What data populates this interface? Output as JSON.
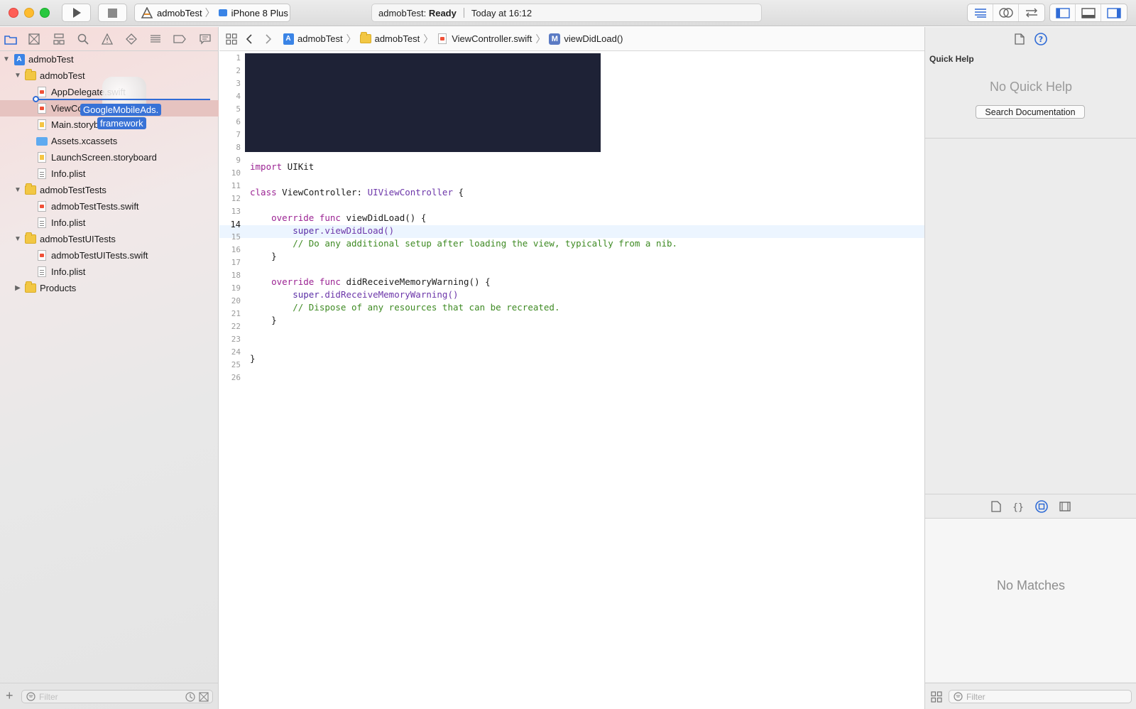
{
  "toolbar": {
    "scheme_name": "admobTest",
    "device_name": "iPhone 8 Plus",
    "status_project": "admobTest:",
    "status_state": "Ready",
    "status_time": "Today at 16:12"
  },
  "navigator": {
    "items": [
      {
        "label": "admobTest",
        "kind": "project",
        "indent": 0,
        "disclosure": "open"
      },
      {
        "label": "admobTest",
        "kind": "folder",
        "indent": 1,
        "disclosure": "open"
      },
      {
        "label": "AppDelegate.swift",
        "kind": "swift",
        "indent": 2
      },
      {
        "label": "ViewCo",
        "kind": "swift",
        "indent": 2,
        "selected": true
      },
      {
        "label": "Main.storyb",
        "kind": "sb",
        "indent": 2
      },
      {
        "label": "Assets.xcassets",
        "kind": "assets",
        "indent": 2
      },
      {
        "label": "LaunchScreen.storyboard",
        "kind": "sb",
        "indent": 2
      },
      {
        "label": "Info.plist",
        "kind": "plist",
        "indent": 2
      },
      {
        "label": "admobTestTests",
        "kind": "folder",
        "indent": 1,
        "disclosure": "open"
      },
      {
        "label": "admobTestTests.swift",
        "kind": "swift",
        "indent": 2
      },
      {
        "label": "Info.plist",
        "kind": "plist",
        "indent": 2
      },
      {
        "label": "admobTestUITests",
        "kind": "folder",
        "indent": 1,
        "disclosure": "open"
      },
      {
        "label": "admobTestUITests.swift",
        "kind": "swift",
        "indent": 2
      },
      {
        "label": "Info.plist",
        "kind": "plist",
        "indent": 2
      },
      {
        "label": "Products",
        "kind": "folder",
        "indent": 1,
        "disclosure": "closed"
      }
    ],
    "drag_label_line1": "GoogleMobileAds.",
    "drag_label_line2": "framework",
    "filter_placeholder": "Filter"
  },
  "jumpbar": {
    "crumbs": [
      "admobTest",
      "admobTest",
      "ViewController.swift",
      "viewDidLoad()"
    ],
    "method_badge": "M"
  },
  "editor": {
    "line_numbers": [
      "1",
      "2",
      "3",
      "4",
      "5",
      "6",
      "7",
      "8",
      "9",
      "10",
      "11",
      "12",
      "13",
      "14",
      "15",
      "16",
      "17",
      "18",
      "19",
      "20",
      "21",
      "22",
      "23",
      "24",
      "25",
      "26"
    ],
    "current_line": "14",
    "lines": {
      "l9_kw": "import",
      "l9_rest": " UIKit",
      "l11_kw": "class",
      "l11_mid": " ViewController: ",
      "l11_ty": "UIViewController",
      "l11_end": " {",
      "l13_kw": "    override func",
      "l13_rest": " viewDidLoad() {",
      "l14_sp": "        super",
      "l14_rest": ".viewDidLoad()",
      "l15_cm": "        // Do any additional setup after loading the view, typically from a nib.",
      "l16": "    }",
      "l18_kw": "    override func",
      "l18_rest": " didReceiveMemoryWarning() {",
      "l19_sp": "        super",
      "l19_rest": ".didReceiveMemoryWarning()",
      "l20_cm": "        // Dispose of any resources that can be recreated.",
      "l21": "    }",
      "l24": "}"
    }
  },
  "inspector": {
    "quick_help_title": "Quick Help",
    "no_quick_help": "No Quick Help",
    "search_docs_label": "Search Documentation",
    "no_matches": "No Matches",
    "filter_placeholder": "Filter"
  },
  "colors": {
    "keyword": "#9b2393",
    "type": "#6c36a9",
    "comment": "#3e8a23",
    "selection": "#2f6bd6"
  }
}
